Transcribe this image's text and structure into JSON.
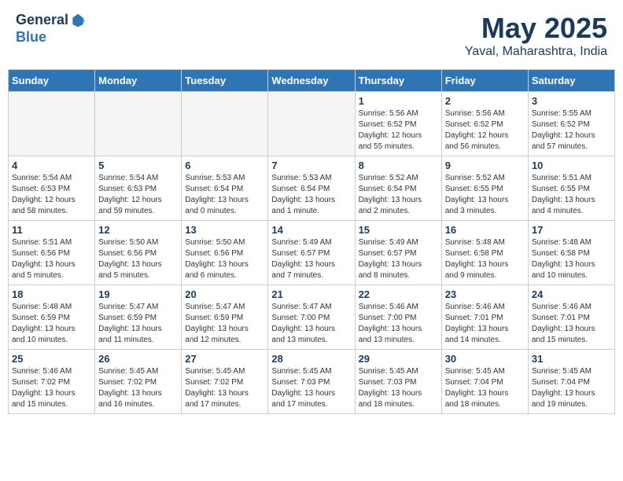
{
  "logo": {
    "line1": "General",
    "line2": "Blue"
  },
  "title": "May 2025",
  "subtitle": "Yaval, Maharashtra, India",
  "weekdays": [
    "Sunday",
    "Monday",
    "Tuesday",
    "Wednesday",
    "Thursday",
    "Friday",
    "Saturday"
  ],
  "weeks": [
    [
      {
        "day": "",
        "info": ""
      },
      {
        "day": "",
        "info": ""
      },
      {
        "day": "",
        "info": ""
      },
      {
        "day": "",
        "info": ""
      },
      {
        "day": "1",
        "info": "Sunrise: 5:56 AM\nSunset: 6:52 PM\nDaylight: 12 hours\nand 55 minutes."
      },
      {
        "day": "2",
        "info": "Sunrise: 5:56 AM\nSunset: 6:52 PM\nDaylight: 12 hours\nand 56 minutes."
      },
      {
        "day": "3",
        "info": "Sunrise: 5:55 AM\nSunset: 6:52 PM\nDaylight: 12 hours\nand 57 minutes."
      }
    ],
    [
      {
        "day": "4",
        "info": "Sunrise: 5:54 AM\nSunset: 6:53 PM\nDaylight: 12 hours\nand 58 minutes."
      },
      {
        "day": "5",
        "info": "Sunrise: 5:54 AM\nSunset: 6:53 PM\nDaylight: 12 hours\nand 59 minutes."
      },
      {
        "day": "6",
        "info": "Sunrise: 5:53 AM\nSunset: 6:54 PM\nDaylight: 13 hours\nand 0 minutes."
      },
      {
        "day": "7",
        "info": "Sunrise: 5:53 AM\nSunset: 6:54 PM\nDaylight: 13 hours\nand 1 minute."
      },
      {
        "day": "8",
        "info": "Sunrise: 5:52 AM\nSunset: 6:54 PM\nDaylight: 13 hours\nand 2 minutes."
      },
      {
        "day": "9",
        "info": "Sunrise: 5:52 AM\nSunset: 6:55 PM\nDaylight: 13 hours\nand 3 minutes."
      },
      {
        "day": "10",
        "info": "Sunrise: 5:51 AM\nSunset: 6:55 PM\nDaylight: 13 hours\nand 4 minutes."
      }
    ],
    [
      {
        "day": "11",
        "info": "Sunrise: 5:51 AM\nSunset: 6:56 PM\nDaylight: 13 hours\nand 5 minutes."
      },
      {
        "day": "12",
        "info": "Sunrise: 5:50 AM\nSunset: 6:56 PM\nDaylight: 13 hours\nand 5 minutes."
      },
      {
        "day": "13",
        "info": "Sunrise: 5:50 AM\nSunset: 6:56 PM\nDaylight: 13 hours\nand 6 minutes."
      },
      {
        "day": "14",
        "info": "Sunrise: 5:49 AM\nSunset: 6:57 PM\nDaylight: 13 hours\nand 7 minutes."
      },
      {
        "day": "15",
        "info": "Sunrise: 5:49 AM\nSunset: 6:57 PM\nDaylight: 13 hours\nand 8 minutes."
      },
      {
        "day": "16",
        "info": "Sunrise: 5:48 AM\nSunset: 6:58 PM\nDaylight: 13 hours\nand 9 minutes."
      },
      {
        "day": "17",
        "info": "Sunrise: 5:48 AM\nSunset: 6:58 PM\nDaylight: 13 hours\nand 10 minutes."
      }
    ],
    [
      {
        "day": "18",
        "info": "Sunrise: 5:48 AM\nSunset: 6:59 PM\nDaylight: 13 hours\nand 10 minutes."
      },
      {
        "day": "19",
        "info": "Sunrise: 5:47 AM\nSunset: 6:59 PM\nDaylight: 13 hours\nand 11 minutes."
      },
      {
        "day": "20",
        "info": "Sunrise: 5:47 AM\nSunset: 6:59 PM\nDaylight: 13 hours\nand 12 minutes."
      },
      {
        "day": "21",
        "info": "Sunrise: 5:47 AM\nSunset: 7:00 PM\nDaylight: 13 hours\nand 13 minutes."
      },
      {
        "day": "22",
        "info": "Sunrise: 5:46 AM\nSunset: 7:00 PM\nDaylight: 13 hours\nand 13 minutes."
      },
      {
        "day": "23",
        "info": "Sunrise: 5:46 AM\nSunset: 7:01 PM\nDaylight: 13 hours\nand 14 minutes."
      },
      {
        "day": "24",
        "info": "Sunrise: 5:46 AM\nSunset: 7:01 PM\nDaylight: 13 hours\nand 15 minutes."
      }
    ],
    [
      {
        "day": "25",
        "info": "Sunrise: 5:46 AM\nSunset: 7:02 PM\nDaylight: 13 hours\nand 15 minutes."
      },
      {
        "day": "26",
        "info": "Sunrise: 5:45 AM\nSunset: 7:02 PM\nDaylight: 13 hours\nand 16 minutes."
      },
      {
        "day": "27",
        "info": "Sunrise: 5:45 AM\nSunset: 7:02 PM\nDaylight: 13 hours\nand 17 minutes."
      },
      {
        "day": "28",
        "info": "Sunrise: 5:45 AM\nSunset: 7:03 PM\nDaylight: 13 hours\nand 17 minutes."
      },
      {
        "day": "29",
        "info": "Sunrise: 5:45 AM\nSunset: 7:03 PM\nDaylight: 13 hours\nand 18 minutes."
      },
      {
        "day": "30",
        "info": "Sunrise: 5:45 AM\nSunset: 7:04 PM\nDaylight: 13 hours\nand 18 minutes."
      },
      {
        "day": "31",
        "info": "Sunrise: 5:45 AM\nSunset: 7:04 PM\nDaylight: 13 hours\nand 19 minutes."
      }
    ]
  ]
}
